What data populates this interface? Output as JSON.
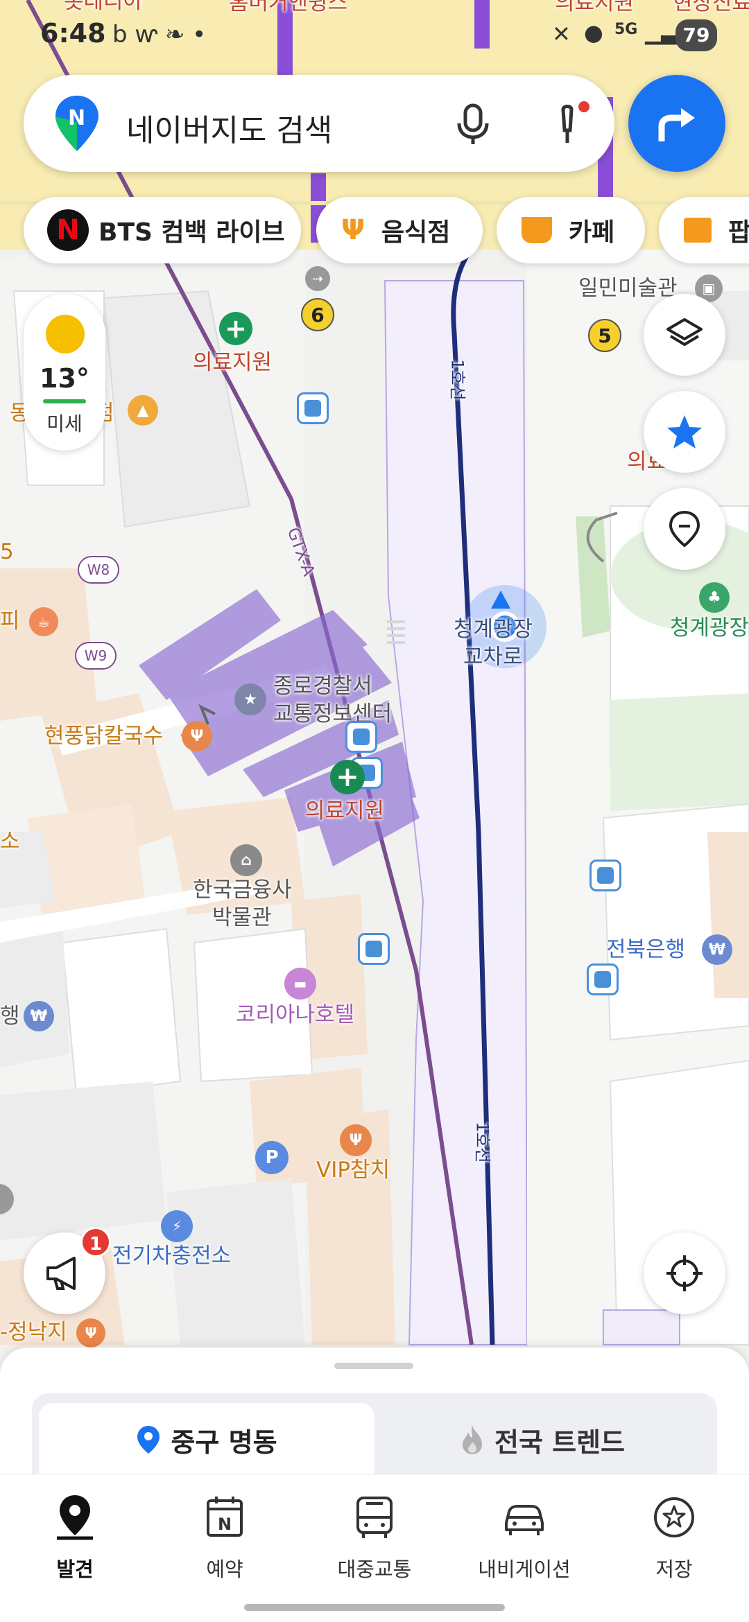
{
  "status_bar": {
    "time": "6:48",
    "network": "5G",
    "battery": "79"
  },
  "search": {
    "placeholder": "네이버지도 검색"
  },
  "chips": [
    {
      "label": "BTS 컴백 라이브",
      "icon": "netflix-icon"
    },
    {
      "label": "음식점",
      "icon": "restaurant-icon"
    },
    {
      "label": "카페",
      "icon": "cafe-icon"
    },
    {
      "label": "팝",
      "icon": "store-icon"
    }
  ],
  "weather": {
    "temp": "13°",
    "air": "미세",
    "icon": "sun-icon"
  },
  "map": {
    "top_labels": {
      "l1": "롯데리아",
      "l2": "홈버거앤윙스",
      "l3": "의료지원",
      "l4": "현장진료"
    },
    "labels": {
      "medical1": "의료지원",
      "medical2": "의료지원",
      "medical3": "의료",
      "store_partial": "동",
      "store_partial2": "점",
      "gallery": "일민미술관",
      "police1": "종로경찰서",
      "police2": "교통정보센터",
      "noodle": "현풍닭칼국수",
      "museum1": "한국금융사",
      "museum2": "박물관",
      "hotel": "코리아나호텔",
      "vip": "VIP참치",
      "ev": "전기차충전소",
      "octopus": "-정낙지",
      "bank": "전북은행",
      "plaza": "청계광장",
      "intersection1": "청계광장",
      "intersection2": "교차로",
      "left_5": "5",
      "left_pi": "피",
      "left_so": "소",
      "left_haeng": "행",
      "w8": "W8",
      "w9": "W9"
    },
    "lines": {
      "line1a": "1호선",
      "line1b": "1호선",
      "gtx": "GTX-A"
    },
    "exits": {
      "exit6": "6",
      "exit5": "5"
    }
  },
  "notice": {
    "badge": "1"
  },
  "sheet": {
    "tab_active": "중구 명동",
    "tab_inactive": "전국 트렌드"
  },
  "nav": [
    {
      "label": "발견",
      "icon": "discover-pin-icon",
      "active": true
    },
    {
      "label": "예약",
      "icon": "calendar-icon",
      "active": false
    },
    {
      "label": "대중교통",
      "icon": "bus-icon",
      "active": false
    },
    {
      "label": "내비게이션",
      "icon": "car-icon",
      "active": false
    },
    {
      "label": "저장",
      "icon": "star-circle-icon",
      "active": false
    }
  ],
  "colors": {
    "accent": "#1a73f0",
    "line1": "#1f2e7a",
    "gtx": "#7b4d8f",
    "highlight": "#8a6bd1"
  }
}
